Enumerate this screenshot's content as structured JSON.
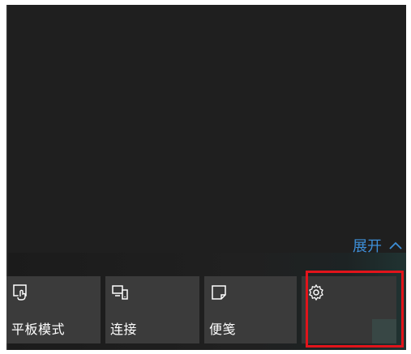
{
  "action_center": {
    "expand_label": "展开",
    "expand_icon": "chevron-up-icon",
    "accent_color": "#3d8fd8",
    "highlight_color": "#e2141b",
    "quick_actions": [
      {
        "label": "平板模式",
        "icon": "tablet-mode-icon"
      },
      {
        "label": "连接",
        "icon": "connect-icon"
      },
      {
        "label": "便笺",
        "icon": "note-icon"
      },
      {
        "label": "",
        "icon": "settings-icon"
      }
    ]
  }
}
